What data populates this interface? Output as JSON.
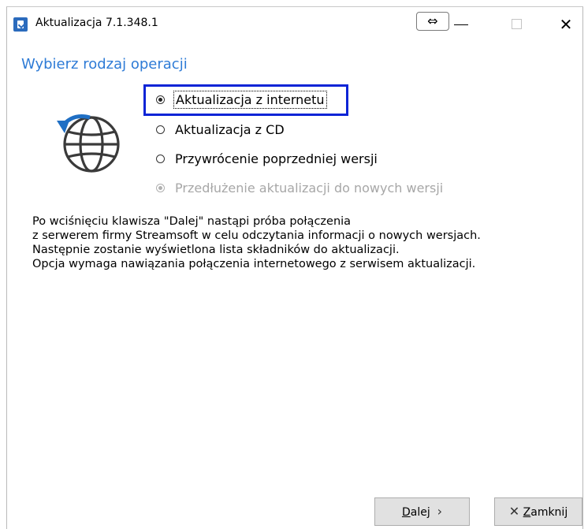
{
  "window": {
    "title": "Aktualizacja 7.1.348.1",
    "resize_glyph": "⇔",
    "close_glyph": "✕"
  },
  "heading": "Wybierz rodzaj operacji",
  "icons": {
    "app": "update-app-icon",
    "globe": "globe-refresh-icon"
  },
  "options": [
    {
      "label": "Aktualizacja z internetu",
      "checked": true,
      "enabled": true,
      "focused": true
    },
    {
      "label": "Aktualizacja z CD",
      "checked": false,
      "enabled": true,
      "focused": false
    },
    {
      "label": "Przywrócenie poprzedniej wersji",
      "checked": false,
      "enabled": true,
      "focused": false
    },
    {
      "label": "Przedłużenie aktualizacji do nowych wersji",
      "checked": false,
      "enabled": false,
      "focused": false
    }
  ],
  "description": [
    "Po wciśnięciu klawisza \"Dalej\" nastąpi próba połączenia",
    "z serwerem firmy Streamsoft w celu odczytania informacji o nowych wersjach.",
    "Następnie zostanie wyświetlona lista składników do aktualizacji.",
    "Opcja wymaga nawiązania połączenia internetowego z serwisem aktualizacji."
  ],
  "buttons": {
    "next_mnemonic": "D",
    "next_rest": "alej",
    "next_glyph": "›",
    "close_glyph": "✕",
    "close_mnemonic": "Z",
    "close_rest": "amknij"
  },
  "colors": {
    "heading": "#2e7bd6",
    "focus_border": "#0b24d6",
    "app_icon": "#2b6bbd"
  }
}
